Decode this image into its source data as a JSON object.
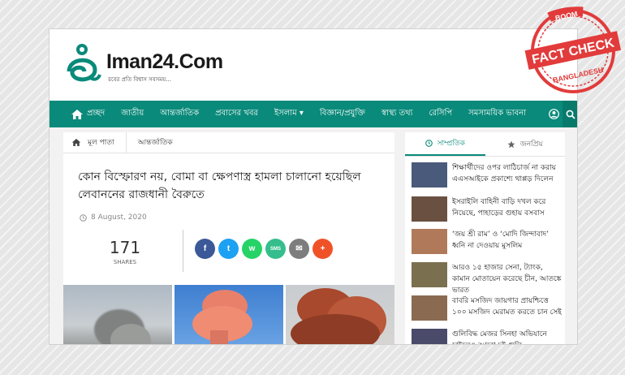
{
  "site": {
    "logo_text": "Iman24.Com",
    "tagline": "রবের প্রতি বিশ্বাস সবসময়..."
  },
  "nav": {
    "home_label": "প্রচ্ছদ",
    "items": [
      "জাতীয়",
      "আন্তর্জাতিক",
      "প্রবাসের খবর",
      "ইসলাম ▾",
      "বিজ্ঞান/প্রযুক্তি",
      "স্বাস্থ্য তথ্য",
      "রেসিপি",
      "সমসাময়িক ভাবনা"
    ]
  },
  "breadcrumb": {
    "home_label": "মূল পাতা",
    "current_label": "আন্তর্জাতিক"
  },
  "article": {
    "title": "কোন বিস্ফোরণ নয়, বোমা বা ক্ষেপণাস্ত্র হামলা চালানো হয়েছিল লেবাননের রাজধানী বৈরুতে",
    "date": "8 August, 2020",
    "share_count": "171",
    "shares_label": "SHARES"
  },
  "share_buttons": [
    {
      "name": "facebook-share-button",
      "icon": "facebook-icon",
      "glyph": "f",
      "color": "#3b5998"
    },
    {
      "name": "twitter-share-button",
      "icon": "twitter-icon",
      "glyph": "t",
      "color": "#1da1f2"
    },
    {
      "name": "whatsapp-share-button",
      "icon": "whatsapp-icon",
      "glyph": "w",
      "color": "#25d366"
    },
    {
      "name": "sms-share-button",
      "icon": "sms-icon",
      "glyph": "SMS",
      "color": "#35be8c"
    },
    {
      "name": "email-share-button",
      "icon": "email-icon",
      "glyph": "✉",
      "color": "#7d7d7d"
    },
    {
      "name": "more-share-button",
      "icon": "plus-icon",
      "glyph": "+",
      "color": "#f05228"
    }
  ],
  "sidebar": {
    "tab_recent": "সাম্প্রতিক",
    "tab_popular": "জনপ্রিয়",
    "items": [
      {
        "text": "শিক্ষার্থীদের ওপর লাঠিচার্জ না করায় এএসআইকে প্রকাশ্যে থাপ্পড় দিলেন",
        "thumb_color": "#4a5a7a"
      },
      {
        "text": "ইসরাইলি বাহিনী বাড়ি দখল করে নিয়েছে, পাহাড়ের গুহায় বসবাস",
        "thumb_color": "#6a5040"
      },
      {
        "text": "‘জয় শ্রী রাম’ ও ‘মোদি জিন্দাবাদ’ ধ্বনি না দেওয়ায় মুসলিম",
        "thumb_color": "#b07a5a"
      },
      {
        "text": "আরও ১৫ হাজার সেনা, ট্যাংক, কামান মোতায়েন করেছে চীন, আতঙ্কে ভারত",
        "thumb_color": "#7a7050"
      },
      {
        "text": "বাবরি মসজিদ জায়গার প্রায়শ্চিত্তে ১০০ মসজিদ মেরামত করতে চান সেই",
        "thumb_color": "#8a6a50"
      },
      {
        "text": "গুলিবিদ্ধ মেজর সিনহা অভিযানে চাইলেও আরো দুই গুলি",
        "thumb_color": "#4a4a6a"
      }
    ]
  },
  "badge": {
    "top_text": "BOOM",
    "main_text": "FACT CHECK",
    "bottom_text": "BANGLADESH",
    "color": "#e23b3b"
  },
  "colors": {
    "nav_bg": "#0a8a7a",
    "accent": "#0a8a7a"
  }
}
